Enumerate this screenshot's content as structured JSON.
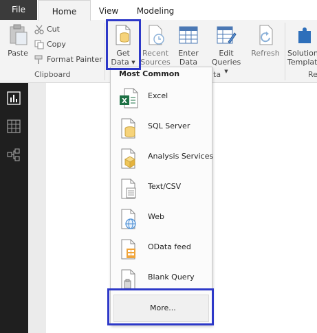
{
  "tabs": {
    "file": "File",
    "home": "Home",
    "view": "View",
    "modeling": "Modeling"
  },
  "clipboard": {
    "paste": "Paste",
    "cut": "Cut",
    "copy": "Copy",
    "format_painter": "Format Painter",
    "group_label": "Clipboard"
  },
  "ribbon": {
    "get_data_line1": "Get",
    "get_data_line2": "Data",
    "recent_sources_line1": "Recent",
    "recent_sources_line2": "Sources",
    "enter_data_line1": "Enter",
    "enter_data_line2": "Data",
    "edit_queries_line1": "Edit",
    "edit_queries_line2": "Queries",
    "refresh": "Refresh",
    "solution_line1": "Solution",
    "solution_line2": "Templat",
    "external_group_partial": "ta",
    "right_group_partial": "Re"
  },
  "dropdown": {
    "header": "Most Common",
    "items": [
      {
        "label": "Excel",
        "icon": "excel-icon"
      },
      {
        "label": "SQL Server",
        "icon": "sql-server-icon"
      },
      {
        "label": "Analysis Services",
        "icon": "analysis-services-icon"
      },
      {
        "label": "Text/CSV",
        "icon": "text-csv-icon"
      },
      {
        "label": "Web",
        "icon": "web-icon"
      },
      {
        "label": "OData feed",
        "icon": "odata-feed-icon"
      },
      {
        "label": "Blank Query",
        "icon": "blank-query-icon"
      }
    ],
    "more": "More..."
  },
  "colors": {
    "highlight": "#2d38c8",
    "accent_yellow": "#f2c811",
    "leftnav_bg": "#1f1f1f",
    "excel_green": "#1e7145"
  }
}
